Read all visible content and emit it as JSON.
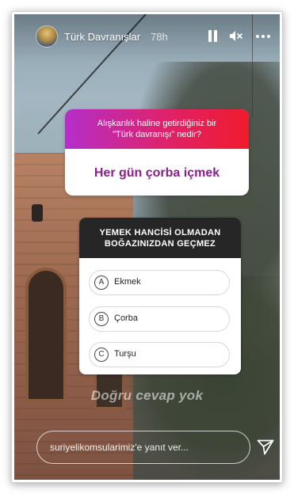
{
  "story": {
    "username": "Türk Davranışlar",
    "timestamp": "78h"
  },
  "controls": {
    "pause_icon": "pause-icon",
    "mute_icon": "mute-icon",
    "more_icon": "more-icon"
  },
  "question_sticker": {
    "question": "Alışkanlık haline getirdiğiniz bir\n\"Türk davranışı\" nedir?",
    "answer": "Her gün çorba içmek",
    "colors": {
      "gradient_start": "#b42ec9",
      "gradient_end": "#f01b2c",
      "answer": "#8a1f8c"
    }
  },
  "quiz_sticker": {
    "title": "YEMEK HANCİSİ OLMADAN\nBOĞAZINIZDAN GEÇMEZ",
    "options": [
      {
        "letter": "A",
        "text": "Ekmek"
      },
      {
        "letter": "B",
        "text": "Çorba"
      },
      {
        "letter": "C",
        "text": "Turşu"
      }
    ]
  },
  "caption": "Doğru cevap yok",
  "reply": {
    "placeholder": "suriyelikomsularimiz'e yanıt ver...",
    "send_icon": "send-icon"
  }
}
